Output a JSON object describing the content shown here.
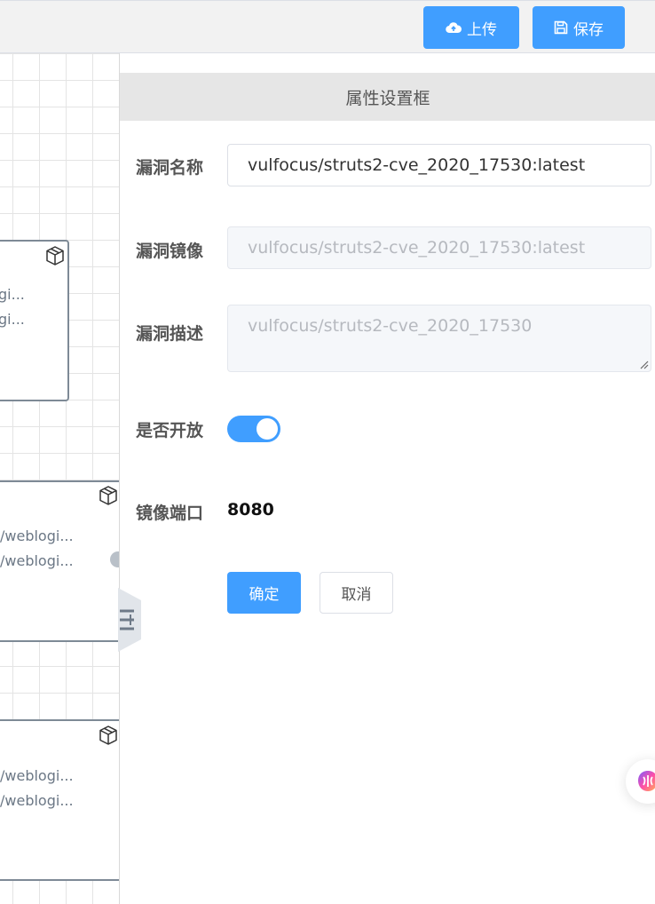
{
  "toolbar": {
    "upload_label": "上传",
    "save_label": "保存"
  },
  "canvas": {
    "nodes": [
      {
        "lines": [
          "gi...",
          "gi..."
        ]
      },
      {
        "lines": [
          "/weblogi...",
          "/weblogi..."
        ]
      },
      {
        "lines": [
          "/weblogi...",
          "/weblogi..."
        ]
      }
    ]
  },
  "panel": {
    "title": "属性设置框",
    "fields": {
      "name": {
        "label": "漏洞名称",
        "value": "vulfocus/struts2-cve_2020_17530:latest"
      },
      "image": {
        "label": "漏洞镜像",
        "value": "vulfocus/struts2-cve_2020_17530:latest"
      },
      "desc": {
        "label": "漏洞描述",
        "value": "vulfocus/struts2-cve_2020_17530"
      },
      "open": {
        "label": "是否开放",
        "value": true
      },
      "port": {
        "label": "镜像端口",
        "value": "8080"
      }
    },
    "confirm_label": "确定",
    "cancel_label": "取消"
  },
  "colors": {
    "primary": "#409eff",
    "toolbar_bg": "#f2f2f2",
    "panel_header_bg": "#e6e6e6"
  },
  "icons": {
    "upload": "cloud-upload-icon",
    "save": "floppy-disk-icon",
    "node": "cube-icon",
    "side_toggle": "menu-collapse-icon",
    "assistant": "ai-assistant-icon"
  }
}
